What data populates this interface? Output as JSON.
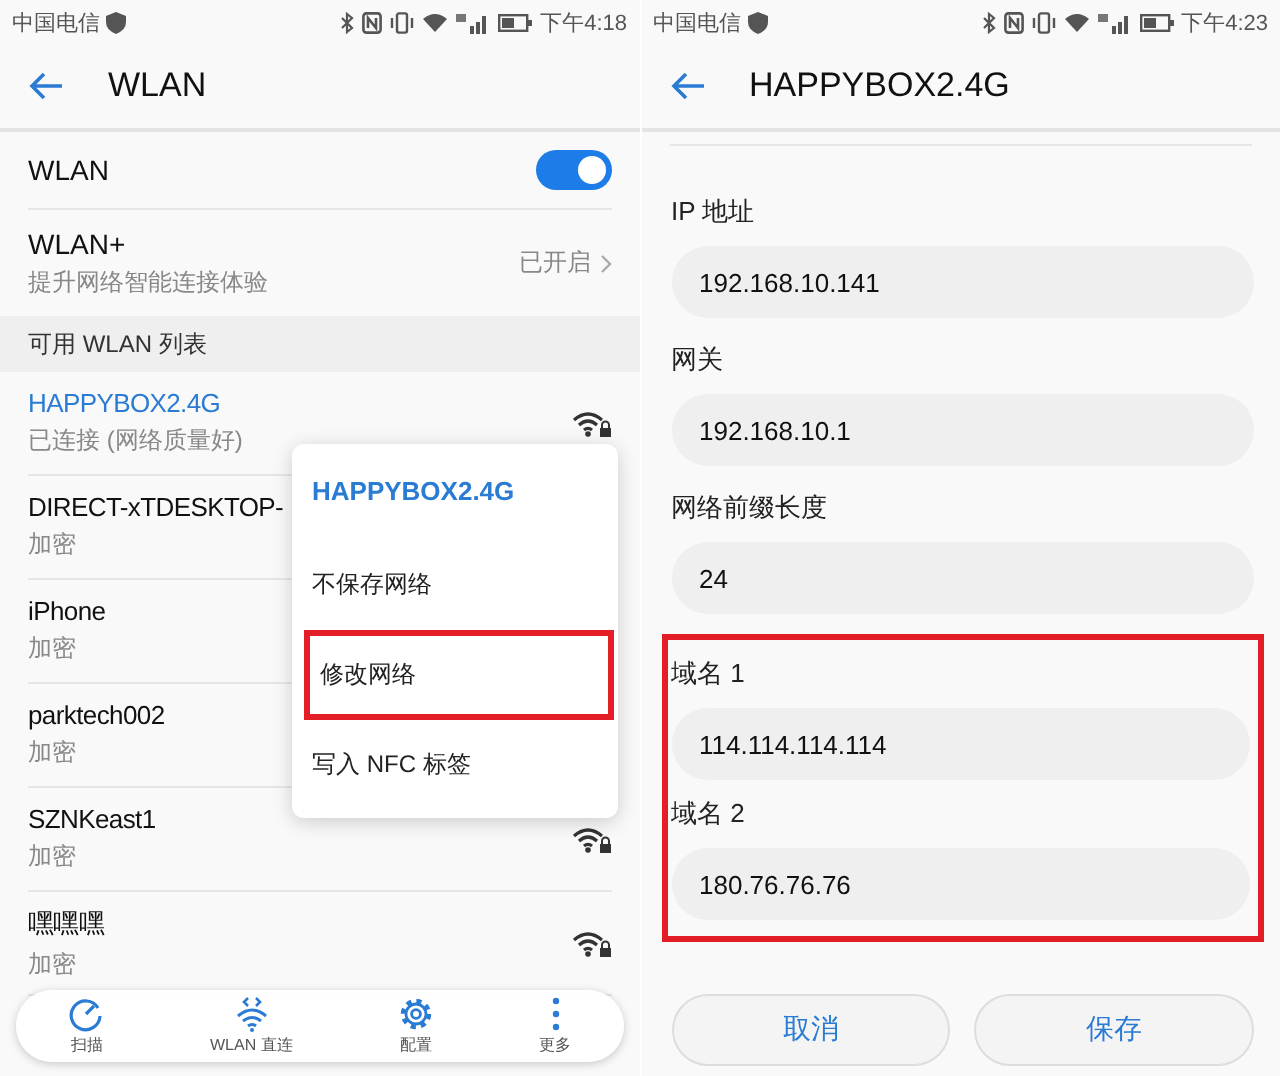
{
  "wlan_screen": {
    "status_bar": {
      "carrier": "中国电信",
      "time": "下午4:18"
    },
    "header": {
      "title": "WLAN"
    },
    "wlan_switch": {
      "label": "WLAN",
      "on": true
    },
    "wlan_plus": {
      "title": "WLAN+",
      "subtitle": "提升网络智能连接体验",
      "value": "已开启"
    },
    "section_title": "可用 WLAN 列表",
    "networks": [
      {
        "name": "HAPPYBOX2.4G",
        "status": "已连接 (网络质量好)",
        "connected": true,
        "icon": true
      },
      {
        "name": "DIRECT-xTDESKTOP-",
        "status": "加密",
        "connected": false,
        "icon": false
      },
      {
        "name": "iPhone",
        "status": "加密",
        "connected": false,
        "icon": false
      },
      {
        "name": "parktech002",
        "status": "加密",
        "connected": false,
        "icon": false
      },
      {
        "name": "SZNKeast1",
        "status": "加密",
        "connected": false,
        "icon": true
      },
      {
        "name": "嘿嘿嘿",
        "status": "加密",
        "connected": false,
        "icon": true
      }
    ],
    "context_menu": {
      "title": "HAPPYBOX2.4G",
      "items": [
        {
          "label": "不保存网络",
          "highlighted": false
        },
        {
          "label": "修改网络",
          "highlighted": true
        },
        {
          "label": "写入 NFC 标签",
          "highlighted": false
        }
      ]
    },
    "bottom_bar": [
      {
        "label": "扫描",
        "kind": "scan"
      },
      {
        "label": "WLAN 直连",
        "kind": "direct"
      },
      {
        "label": "配置",
        "kind": "config"
      },
      {
        "label": "更多",
        "kind": "more"
      }
    ]
  },
  "detail_screen": {
    "status_bar": {
      "carrier": "中国电信",
      "time": "下午4:23"
    },
    "header": {
      "title": "HAPPYBOX2.4G"
    },
    "fields": [
      {
        "label": "IP 地址",
        "value": "192.168.10.141",
        "highlighted": false
      },
      {
        "label": "网关",
        "value": "192.168.10.1",
        "highlighted": false
      },
      {
        "label": "网络前缀长度",
        "value": "24",
        "highlighted": false
      },
      {
        "label": "域名 1",
        "value": "114.114.114.114",
        "highlighted": true
      },
      {
        "label": "域名 2",
        "value": "180.76.76.76",
        "highlighted": true
      }
    ],
    "buttons": [
      {
        "label": "取消"
      },
      {
        "label": "保存"
      }
    ]
  }
}
